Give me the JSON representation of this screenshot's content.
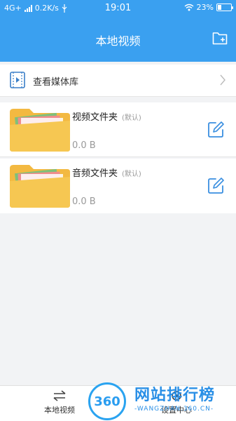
{
  "status_bar": {
    "network": "4G+",
    "speed": "0.2K/s",
    "time": "19:01",
    "battery": "23%"
  },
  "header": {
    "title": "本地视频",
    "add_folder_icon": "add-folder-icon"
  },
  "media_library": {
    "label": "查看媒体库"
  },
  "folders": [
    {
      "name": "视频文件夹",
      "tag": "(默认)",
      "size": "0.0 B"
    },
    {
      "name": "音频文件夹",
      "tag": "(默认)",
      "size": "0.0 B"
    }
  ],
  "bottom_nav": [
    {
      "label": "本地视频",
      "icon": "swap-arrows-icon"
    },
    {
      "label": "设置中心",
      "icon": "settings-icon"
    }
  ],
  "watermark": {
    "logo_text": "360",
    "name": "网站排行榜",
    "url": "-WANGZHAN.360.CN-"
  },
  "colors": {
    "header_bg": "#3aa0f0",
    "folder_yellow": "#f6c752",
    "edit_blue": "#3a8fe0"
  }
}
